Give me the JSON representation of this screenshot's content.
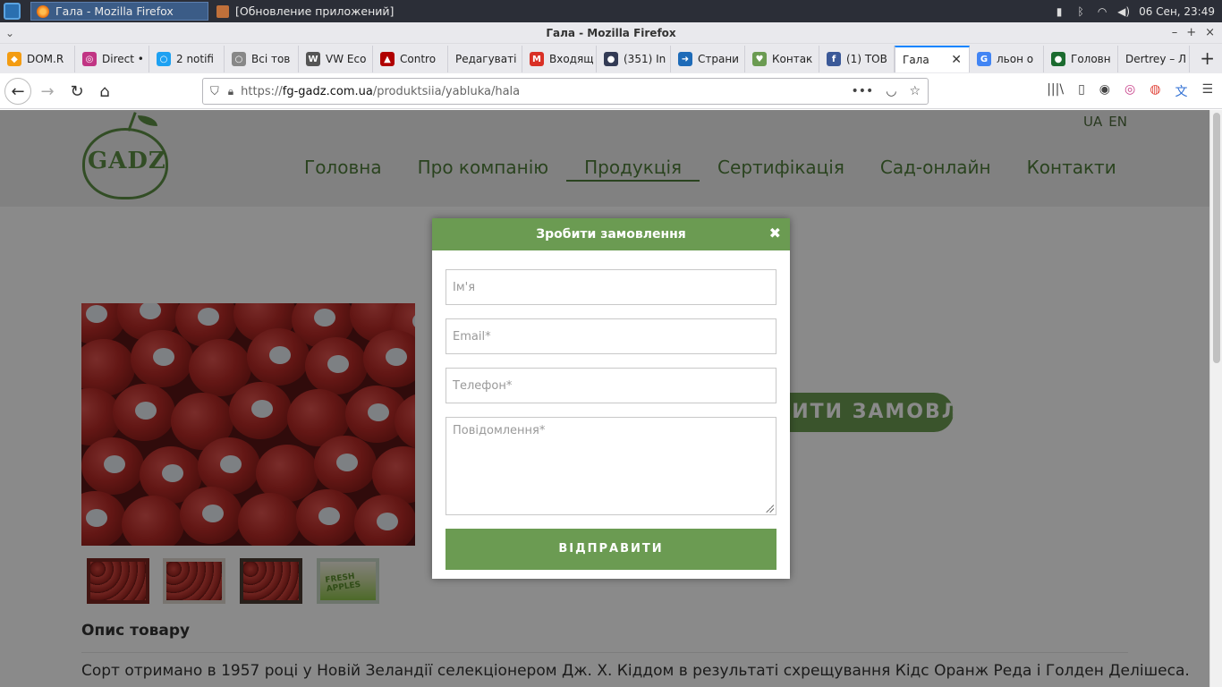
{
  "os": {
    "tasks": [
      {
        "label": "Гала - Mozilla Firefox",
        "icon": "firefox-icon"
      },
      {
        "label": "[Обновление приложений]",
        "icon": "update-icon"
      }
    ],
    "clock": "06 Сен, 23:49"
  },
  "window": {
    "title": "Гала - Mozilla Firefox",
    "controls": [
      "–",
      "+",
      "×"
    ]
  },
  "tabs": [
    {
      "label": "DOM.R",
      "fav_color": "#f39c12",
      "fav_text": "◆"
    },
    {
      "label": "Direct •",
      "fav_color": "#c13584",
      "fav_text": "◎"
    },
    {
      "label": "2 notifi",
      "fav_color": "#1da1f2",
      "fav_text": "○"
    },
    {
      "label": "Всі тов",
      "fav_color": "#888888",
      "fav_text": "○"
    },
    {
      "label": "VW Eco",
      "fav_color": "#555555",
      "fav_text": "W"
    },
    {
      "label": "Contro",
      "fav_color": "#b00000",
      "fav_text": "▲"
    },
    {
      "label": "Редагуваті",
      "fav_color": "",
      "fav_text": ""
    },
    {
      "label": "Входящ",
      "fav_color": "#d93025",
      "fav_text": "M"
    },
    {
      "label": "(351) In",
      "fav_color": "#333b55",
      "fav_text": "●"
    },
    {
      "label": "Страни",
      "fav_color": "#1e6bb8",
      "fav_text": "➜"
    },
    {
      "label": "Контак",
      "fav_color": "#6b9b52",
      "fav_text": "♥"
    },
    {
      "label": "(1) ТОВ",
      "fav_color": "#3b5998",
      "fav_text": "f"
    },
    {
      "label": "Гала",
      "fav_color": "",
      "fav_text": "",
      "active": true
    },
    {
      "label": "льон о",
      "fav_color": "#4285f4",
      "fav_text": "G"
    },
    {
      "label": "Головн",
      "fav_color": "#1b6b2f",
      "fav_text": "●"
    },
    {
      "label": "Dertrey – Л",
      "fav_color": "",
      "fav_text": ""
    }
  ],
  "urlbar": {
    "prefix": "https://",
    "host": "fg-gadz.com.ua",
    "path": "/produktsiia/yabluka/hala"
  },
  "site": {
    "logo_text": "GADZ",
    "lang": [
      "UA",
      "EN"
    ],
    "nav": [
      "Головна",
      "Про компанію",
      "Продукція",
      "Сертифікація",
      "Сад-онлайн",
      "Контакти"
    ],
    "nav_active_index": 2,
    "order_button": "ЗРОБИТИ ЗАМОВЛЕННЯ",
    "thumb_brand": "FRESH APPLES",
    "description_title": "Опис товару",
    "description_text": "Сорт отримано в 1957 році у Новій Зеландії селекціонером Дж. Х. Кіддом в результаті схрещування Кідс Оранж Реда і Голден Делішеса."
  },
  "modal": {
    "title": "Зробити замовлення",
    "close": "✖",
    "name_placeholder": "Ім'я",
    "email_placeholder": "Email*",
    "phone_placeholder": "Телефон*",
    "message_placeholder": "Повідомлення*",
    "submit": "ВІДПРАВИТИ"
  },
  "colors": {
    "brand_green": "#6b9b52",
    "nav_green": "#4f7d3a",
    "tab_accent": "#0a84ff"
  }
}
